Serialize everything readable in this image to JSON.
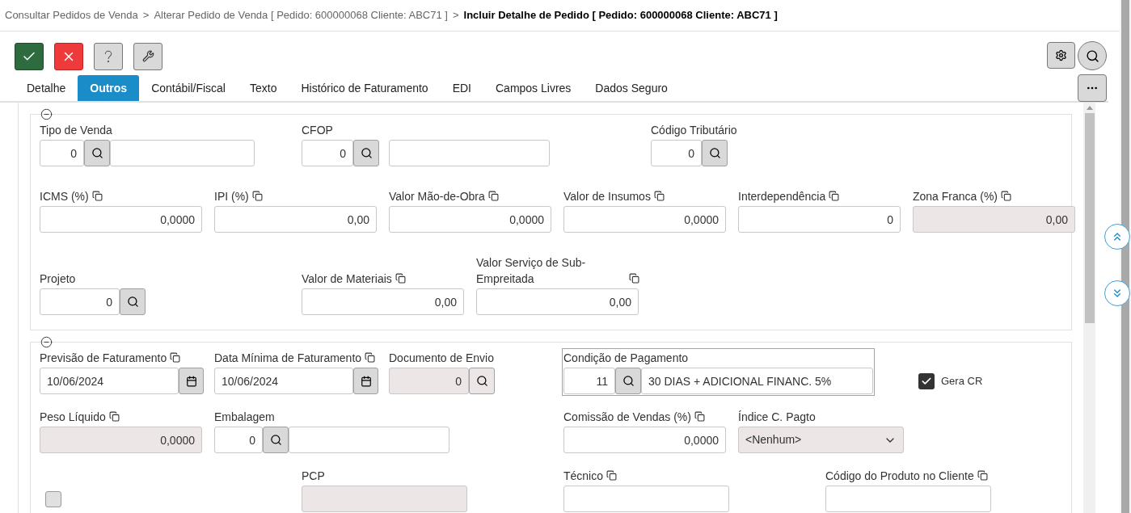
{
  "breadcrumb": [
    {
      "kind": "link",
      "text": "Consultar Pedidos de Venda"
    },
    {
      "kind": "separator",
      "text": ">"
    },
    {
      "kind": "link",
      "text": "Alterar Pedido de Venda [ Pedido: 600000068 Cliente: ABC71 ]"
    },
    {
      "kind": "separator",
      "text": ">"
    },
    {
      "kind": "current",
      "text": "Incluir Detalhe de Pedido [ Pedido: 600000068 Cliente: ABC71 ]"
    }
  ],
  "toolbar": [
    {
      "kind": "confirm"
    },
    {
      "kind": "cancel"
    },
    {
      "kind": "help"
    },
    {
      "kind": "tools"
    }
  ],
  "tabs": [
    {
      "label": "Detalhe",
      "selected": false
    },
    {
      "label": "Outros",
      "selected": true
    },
    {
      "label": "Contábil/Fiscal",
      "selected": false
    },
    {
      "label": "Texto",
      "selected": false
    },
    {
      "label": "Histórico de Faturamento",
      "selected": false
    },
    {
      "label": "EDI",
      "selected": false
    },
    {
      "label": "Campos Livres",
      "selected": false
    },
    {
      "label": "Dados Seguro",
      "selected": false
    }
  ],
  "sections": [
    {
      "expanded": true,
      "rows": [
        [
          {
            "kind": "lookup_desc",
            "label": "Tipo de Venda",
            "value": "0"
          },
          {
            "kind": "lookup_desc",
            "label": "CFOP",
            "value": "0"
          },
          "",
          {
            "kind": "lookup",
            "label": "Código Tributário",
            "value": "0"
          }
        ],
        [
          {
            "kind": "number",
            "label": "ICMS (%)",
            "copyable": true,
            "value": "0,0000",
            "disabled": false
          },
          {
            "kind": "number",
            "label": "IPI (%)",
            "copyable": true,
            "value": "0,00",
            "disabled": false
          },
          {
            "kind": "number",
            "label": "Valor Mão-de-Obra",
            "copyable": true,
            "value": "0,0000",
            "disabled": false
          },
          {
            "kind": "number",
            "label": "Valor de Insumos",
            "copyable": true,
            "value": "0,0000",
            "disabled": false
          },
          {
            "kind": "number",
            "label": "Interdependência",
            "copyable": true,
            "value": "0",
            "disabled": false
          },
          {
            "kind": "number",
            "label": "Zona Franca (%)",
            "copyable": true,
            "value": "0,00",
            "disabled": true
          }
        ],
        [
          {
            "kind": "lookup",
            "label": "Projeto",
            "value": "0"
          },
          {
            "kind": "number",
            "label": "Valor de Materiais",
            "copyable": true,
            "value": "0,00",
            "disabled": false
          },
          {
            "kind": "number",
            "label": "Valor Serviço de Sub-Empreitada",
            "copyable": true,
            "value": "0,00",
            "disabled": false
          }
        ]
      ]
    },
    {
      "expanded": true,
      "rows": [
        [
          {
            "kind": "date",
            "label": "Previsão de Faturamento",
            "copyable": true,
            "value": "10/06/2024"
          },
          {
            "kind": "date",
            "label": "Data Mínima de Faturamento",
            "copyable": true,
            "value": "10/06/2024"
          },
          {
            "kind": "lookup",
            "label": "Documento de Envio",
            "value": "0",
            "disabled": true
          },
          {
            "kind": "lookup_desc",
            "label": "Condição de Pagamento",
            "value": "11",
            "description": "30 DIAS + ADICIONAL FINANC. 5%",
            "highlighted": true
          },
          {
            "kind": "checkbox",
            "label": "Gera CR",
            "checked": true
          }
        ],
        [
          {
            "kind": "number",
            "label": "Peso Líquido",
            "copyable": true,
            "value": "0,0000",
            "disabled": true
          },
          {
            "kind": "lookup_desc",
            "label": "Embalagem",
            "value": "0"
          },
          "",
          {
            "kind": "number",
            "label": "Comissão de Vendas (%)",
            "copyable": true,
            "value": "0,0000",
            "disabled": false
          },
          {
            "kind": "select",
            "label": "Índice C. Pagto",
            "value": "<Nenhum>"
          }
        ],
        [
          {
            "kind": "checkbox",
            "checked": false
          },
          {
            "kind": "number",
            "label": "PCP",
            "disabled": true
          },
          "",
          {
            "kind": "number",
            "label": "Técnico",
            "copyable": true,
            "disabled": false
          },
          {
            "kind": "number",
            "label": "Código do Produto no Cliente",
            "copyable": true,
            "disabled": false
          }
        ]
      ]
    }
  ]
}
